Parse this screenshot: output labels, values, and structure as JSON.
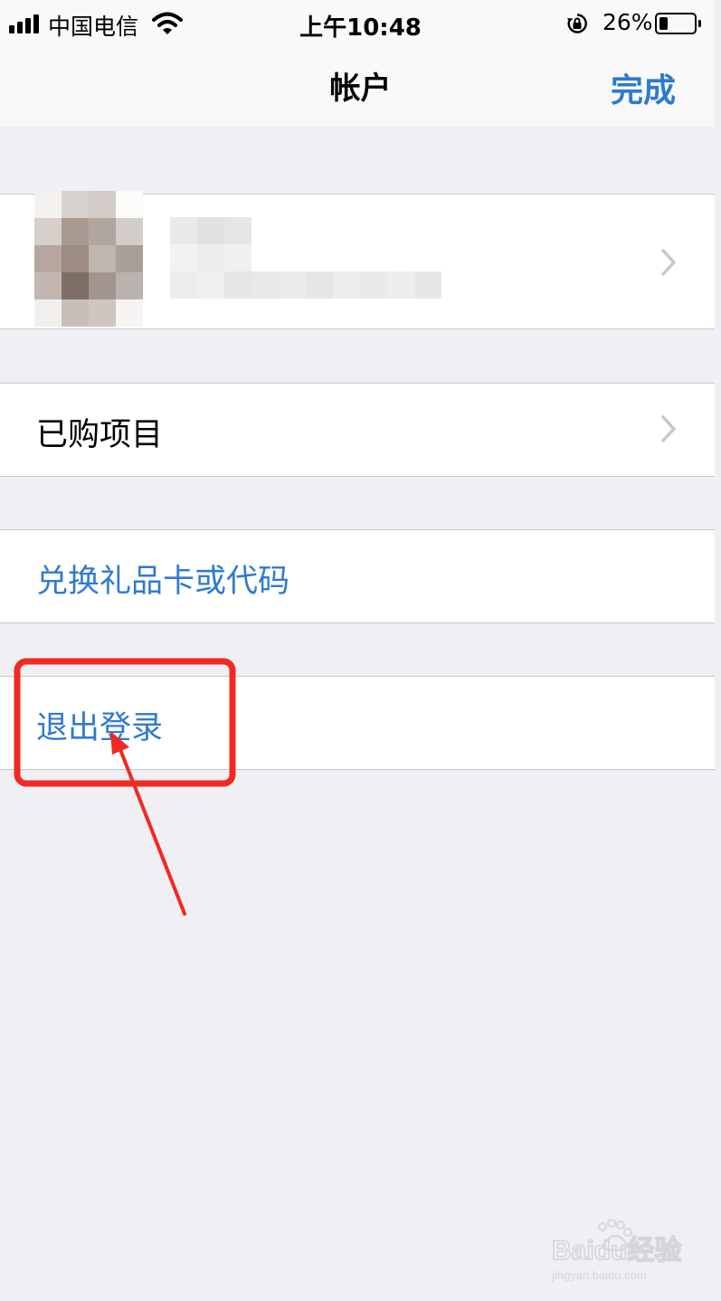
{
  "status_bar": {
    "carrier": "中国电信",
    "time": "上午10:48",
    "battery_percent": "26%",
    "battery_level": 0.26,
    "icons": [
      "signal-bars-icon",
      "wifi-icon",
      "orientation-lock-icon",
      "battery-icon"
    ]
  },
  "nav": {
    "title": "帐户",
    "done_label": "完成"
  },
  "account": {
    "avatar": "blurred",
    "name": "blurred",
    "email": "blurred"
  },
  "rows": {
    "purchased": "已购项目",
    "redeem": "兑换礼品卡或代码",
    "sign_out": "退出登录"
  },
  "watermark": {
    "logo_text": "Baidu经验",
    "url": "jingyan.baidu.com"
  },
  "colors": {
    "accent_blue": "#2f7ad1",
    "annotation_red": "#f02a22",
    "background": "#efeff4"
  }
}
